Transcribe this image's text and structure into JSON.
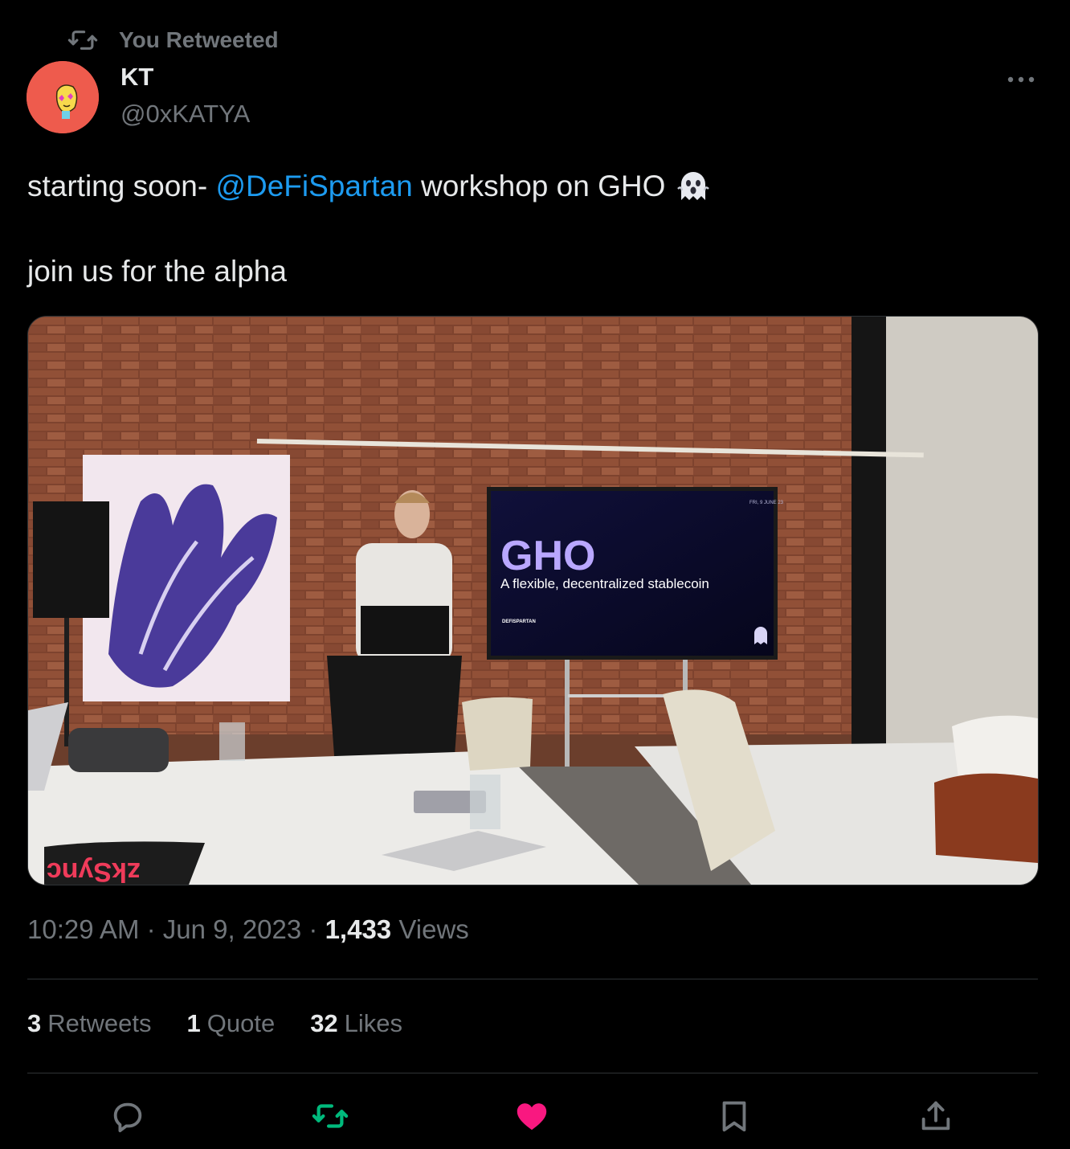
{
  "retweet_context": {
    "label": "You Retweeted",
    "icon": "retweet-icon"
  },
  "author": {
    "display_name": "KT",
    "handle": "@0xKATYA",
    "avatar_color": "#ee5b4d"
  },
  "tweet": {
    "line1_before": "starting soon- ",
    "mention": "@DeFiSpartan",
    "line1_after": " workshop on GHO",
    "line1_emoji": "ghost-emoji",
    "line2": "join us for the alpha"
  },
  "media": {
    "slide_title": "GHO",
    "slide_subtitle": "A flexible, decentralized stablecoin",
    "slide_brand": "DEFISPARTAN",
    "slide_date": "FRI, 9 JUNE 23",
    "sleeve_text": "zkSync"
  },
  "meta": {
    "time": "10:29 AM",
    "separator": " · ",
    "date": "Jun 9, 2023",
    "views_count": "1,433",
    "views_label": "Views"
  },
  "stats": {
    "retweets_count": "3",
    "retweets_label": "Retweets",
    "quotes_count": "1",
    "quotes_label": "Quote",
    "likes_count": "32",
    "likes_label": "Likes"
  },
  "colors": {
    "background": "#000000",
    "text": "#e7e9ea",
    "muted": "#71767b",
    "link": "#1d9bf0",
    "retweeted": "#00ba7c",
    "liked": "#f91880",
    "divider": "#2f3336"
  },
  "actions": [
    "reply-icon",
    "retweet-icon",
    "like-icon",
    "bookmark-icon",
    "share-icon"
  ]
}
